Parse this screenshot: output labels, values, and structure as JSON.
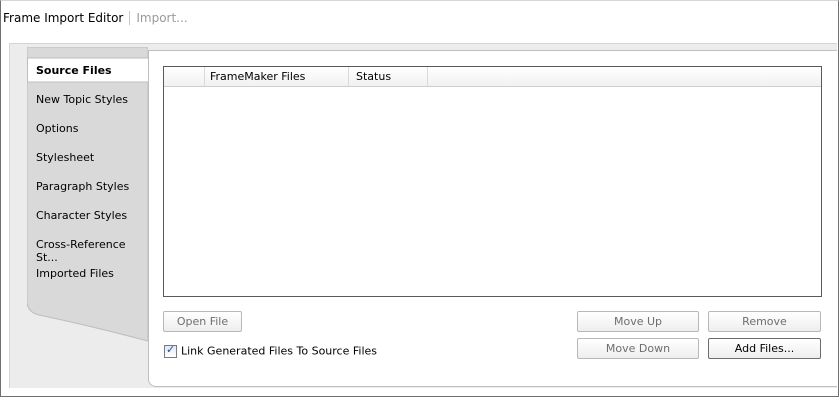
{
  "title": {
    "main": "Frame Import Editor",
    "sub": "Import..."
  },
  "tabs": [
    {
      "label": "Source Files",
      "active": true
    },
    {
      "label": "New Topic Styles",
      "active": false
    },
    {
      "label": "Options",
      "active": false
    },
    {
      "label": "Stylesheet",
      "active": false
    },
    {
      "label": "Paragraph Styles",
      "active": false
    },
    {
      "label": "Character Styles",
      "active": false
    },
    {
      "label": "Cross-Reference St...",
      "active": false
    },
    {
      "label": "Imported Files",
      "active": false
    }
  ],
  "table": {
    "columns": [
      "FrameMaker Files",
      "Status"
    ],
    "rows": []
  },
  "buttons": {
    "open_file": "Open File",
    "move_up": "Move Up",
    "remove": "Remove",
    "move_down": "Move Down",
    "add_files": "Add Files..."
  },
  "link_checkbox": {
    "label": "Link Generated Files To Source Files",
    "checked": true
  },
  "colors": {
    "tab_background": "#d9d9d9",
    "panel_background": "#ececec",
    "check_color": "#2a4d9a"
  }
}
